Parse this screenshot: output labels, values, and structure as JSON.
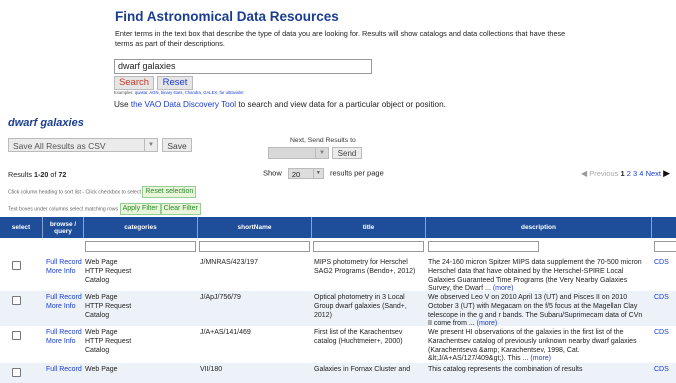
{
  "header": {
    "title": "Find Astronomical Data Resources",
    "description": "Enter terms in the text box that describe the type of data you are looking for.  Results will show catalogs and data collections that have these terms as part of their descriptions.",
    "search_value": "dwarf galaxies",
    "search_button": "Search",
    "reset_button": "Reset",
    "examples_label": "Examples:",
    "examples": [
      "quasar",
      "AGN",
      "binary stars",
      "Chandra",
      "GALEX",
      "far ultraviolet"
    ],
    "vao_prefix": "Use ",
    "vao_link": "the VAO Data Discovery Tool",
    "vao_suffix": " to search and view data for a particular object or position."
  },
  "query_heading": "dwarf galaxies",
  "toolbar": {
    "save_select": "Save All Results as CSV",
    "save_button": "Save",
    "send_label": "Next, Send Results to",
    "send_select": "",
    "send_button": "Send"
  },
  "results": {
    "prefix": "Results ",
    "range": "1-20",
    "of": " of ",
    "total": "72",
    "show_label": "Show",
    "per_page": "20",
    "per_page_suffix": "results per page",
    "previous": "Previous",
    "pages": [
      "1",
      "2",
      "3",
      "4"
    ],
    "current_page": "1",
    "next": "Next"
  },
  "hints": {
    "sort_hint": "Click column heading to sort list - Click checkbox to select",
    "reset_selection": "Reset selection",
    "filter_hint": "Text boxes under columns select matching rows",
    "apply_filter": "Apply Filter",
    "clear_filter": "Clear Filter"
  },
  "table": {
    "columns": [
      "select",
      "browse / query",
      "categories",
      "shortName",
      "title",
      "description",
      ""
    ],
    "full_record_label": "Full Record",
    "more_info_label": "More Info",
    "more_label": "(more)",
    "rows": [
      {
        "categories": [
          "Web Page",
          "HTTP Request",
          "Catalog"
        ],
        "shortName": "J/MNRAS/423/197",
        "title": "MIPS photometry for Herschel SAG2 Programs (Bendo+, 2012)",
        "description": "The 24-160 micron Spitzer MIPS data supplement the 70-500 micron Herschel data that have obtained by the Herschel-SPIRE Local Galaxies Guaranteed Time Programs (the Very Nearby Galaxies Survey, the Dwarf ...",
        "publisher": "CDS"
      },
      {
        "categories": [
          "Web Page",
          "HTTP Request",
          "Catalog"
        ],
        "shortName": "J/ApJ/756/79",
        "title": "Optical photometry in 3 Local Group dwarf galaxies (Sand+, 2012)",
        "description": "We observed Leo V on 2010 April 13 (UT) and Pisces II on 2010 October 3 (UT) with Megacam on the f/5 focus at the Magellan Clay telescope in the g and r bands. The Subaru/Suprimecam data of CVn II come from ...",
        "publisher": "CDS"
      },
      {
        "categories": [
          "Web Page",
          "HTTP Request",
          "Catalog"
        ],
        "shortName": "J/A+AS/141/469",
        "title": "First list of the Karachentsev catalog (Huchtmeier+, 2000)",
        "description": "We present HI observations of the galaxies in the first list of the Karachentsev catalog of previously unknown nearby dwarf galaxies (Karachentseva &amp; Karachentsev, 1998, Cat. &lt;J/A+AS/127/409&gt;). This ...",
        "publisher": "CDS"
      },
      {
        "categories": [
          "Web Page"
        ],
        "shortName": "VII/180",
        "title": "Galaxies in Fornax Cluster and",
        "description": "This catalog represents the combination of results",
        "publisher": "CDS"
      }
    ]
  }
}
